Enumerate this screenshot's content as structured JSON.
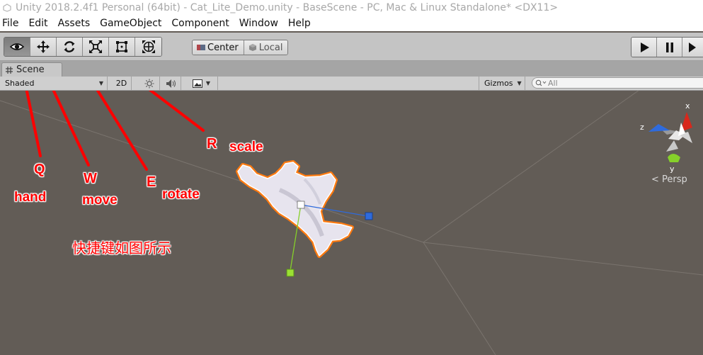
{
  "window": {
    "title": "Unity 2018.2.4f1 Personal (64bit) - Cat_Lite_Demo.unity - BaseScene - PC, Mac & Linux Standalone* <DX11>"
  },
  "menu": [
    "File",
    "Edit",
    "Assets",
    "GameObject",
    "Component",
    "Window",
    "Help"
  ],
  "toolbar": {
    "tools": [
      {
        "name": "hand-tool",
        "icon": "eye-icon",
        "active": true
      },
      {
        "name": "move-tool",
        "icon": "move-arrows-icon",
        "active": false
      },
      {
        "name": "rotate-tool",
        "icon": "rotate-icon",
        "active": false
      },
      {
        "name": "scale-tool",
        "icon": "scale-icon",
        "active": false
      },
      {
        "name": "rect-tool",
        "icon": "rect-icon",
        "active": false
      },
      {
        "name": "transform-tool",
        "icon": "transform-icon",
        "active": false
      }
    ],
    "pivot_label": "Center",
    "space_label": "Local",
    "play_icons": [
      "play-icon",
      "pause-icon",
      "step-icon"
    ]
  },
  "scene_tab": {
    "label": "Scene"
  },
  "scene_toolbar": {
    "shading_mode": "Shaded",
    "mode_2d": "2D",
    "gizmos_label": "Gizmos",
    "search_placeholder": "All"
  },
  "gizmo": {
    "axis_x": "x",
    "axis_y": "y",
    "axis_z": "z",
    "projection": "< Persp"
  },
  "annotations": {
    "q_key": "Q",
    "q_label": "hand",
    "w_key": "W",
    "w_label": "move",
    "e_key": "E",
    "e_label": "rotate",
    "r_key": "R",
    "r_label": "scale",
    "note": "快捷键如图所示"
  },
  "colors": {
    "annotation_red": "#ff0000",
    "scene_bg": "#625c56",
    "selection_outline": "#ff7a10",
    "axis_x": "#d8281c",
    "axis_y": "#86d02a",
    "axis_z": "#2f6bdc"
  }
}
